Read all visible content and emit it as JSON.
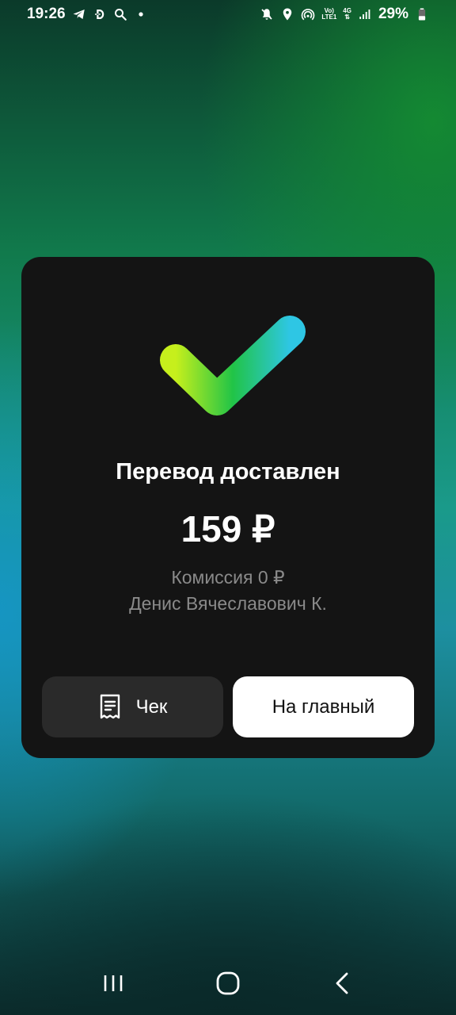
{
  "status_bar": {
    "time": "19:26",
    "battery": "29%",
    "network_top": "Vo)",
    "network_bottom": "LTE1",
    "network_type": "4G",
    "icons": [
      "telegram-icon",
      "dogecoin-icon",
      "search-icon",
      "dot-icon",
      "mute-icon",
      "location-icon",
      "hotspot-icon",
      "signal-icon",
      "battery-icon"
    ]
  },
  "result": {
    "title": "Перевод доставлен",
    "amount": "159 ₽",
    "commission": "Комиссия 0 ₽",
    "recipient": "Денис Вячеславович К."
  },
  "actions": {
    "receipt_label": "Чек",
    "home_label": "На главный"
  },
  "colors": {
    "card_bg": "#141414",
    "check_start": "#c6ef1c",
    "check_mid": "#21c447",
    "check_end": "#2ec6e4",
    "secondary_text": "#8a8a8a"
  },
  "nav": {
    "icons": [
      "recents-icon",
      "home-icon",
      "back-icon"
    ]
  }
}
